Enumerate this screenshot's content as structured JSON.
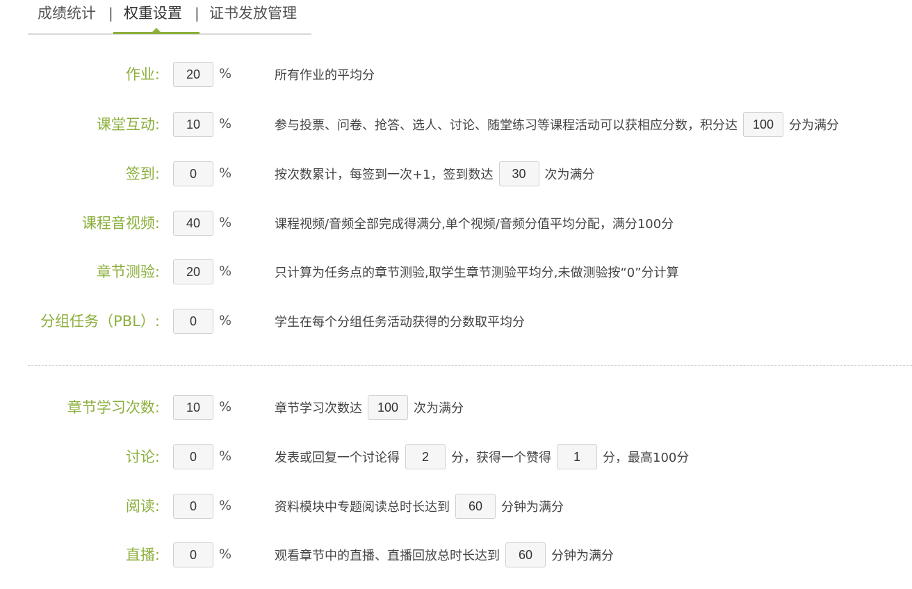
{
  "tabs": {
    "items": [
      {
        "label": "成绩统计"
      },
      {
        "label": "权重设置"
      },
      {
        "label": "证书发放管理"
      }
    ],
    "separator": "|",
    "active_index": 1
  },
  "percent_sign": "%",
  "accent_color": "#8caf3c",
  "rows": [
    {
      "label": "作业:",
      "weight": "20",
      "desc": {
        "text1": "所有作业的平均分"
      }
    },
    {
      "label": "课堂互动:",
      "weight": "10",
      "desc": {
        "text1": "参与投票、问卷、抢答、选人、讨论、随堂练习等课程活动可以获相应分数，积分达",
        "input1": "100",
        "text2": "分为满分"
      }
    },
    {
      "label": "签到:",
      "weight": "0",
      "desc": {
        "text1": "按次数累计，每签到一次+1，签到数达",
        "input1": "30",
        "text2": "次为满分"
      }
    },
    {
      "label": "课程音视频:",
      "weight": "40",
      "desc": {
        "text1": "课程视频/音频全部完成得满分,单个视频/音频分值平均分配，满分100分"
      }
    },
    {
      "label": "章节测验:",
      "weight": "20",
      "desc": {
        "text1": "只计算为任务点的章节测验,取学生章节测验平均分,未做测验按“0”分计算"
      }
    },
    {
      "label": "分组任务（PBL）:",
      "weight": "0",
      "desc": {
        "text1": "学生在每个分组任务活动获得的分数取平均分"
      }
    },
    {
      "label": "章节学习次数:",
      "weight": "10",
      "desc": {
        "text1": "章节学习次数达",
        "input1": "100",
        "text2": "次为满分"
      }
    },
    {
      "label": "讨论:",
      "weight": "0",
      "desc": {
        "text1": "发表或回复一个讨论得",
        "input1": "2",
        "text2": "分，获得一个赞得",
        "input2": "1",
        "text3": "分，最高100分"
      }
    },
    {
      "label": "阅读:",
      "weight": "0",
      "desc": {
        "text1": "资料模块中专题阅读总时长达到",
        "input1": "60",
        "text2": "分钟为满分"
      }
    },
    {
      "label": "直播:",
      "weight": "0",
      "desc": {
        "text1": "观看章节中的直播、直播回放总时长达到",
        "input1": "60",
        "text2": "分钟为满分"
      }
    }
  ]
}
